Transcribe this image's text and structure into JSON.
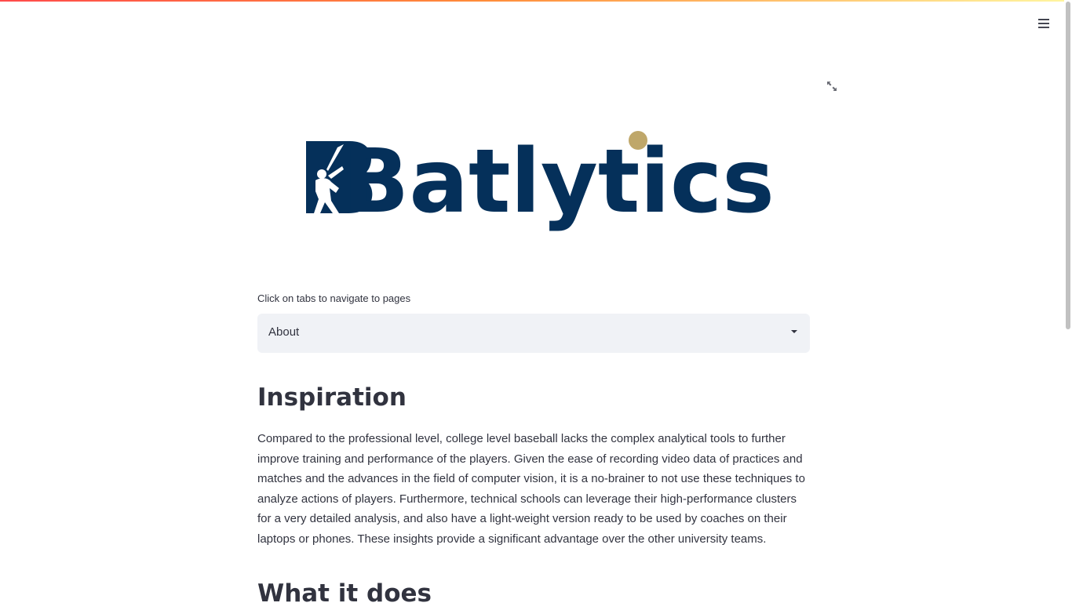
{
  "app": {
    "header": {
      "menu_icon": "hamburger-menu-icon"
    },
    "hero": {
      "logo_text": "Batlytics",
      "logo_colors": {
        "primary": "#05305a",
        "accent": "#bfa76a"
      },
      "fullscreen_icon": "expand-arrows-icon"
    },
    "navigation": {
      "label": "Click on tabs to navigate to pages",
      "selected_value": "About",
      "caret_icon": "caret-down-icon"
    },
    "content": {
      "sections": [
        {
          "heading": "Inspiration",
          "body": "Compared to the professional level, college level baseball lacks the complex analytical tools to further improve training and performance of the players. Given the ease of recording video data of practices and matches and the advances in the field of computer vision, it is a no-brainer to not use these techniques to analyze actions of players. Furthermore, technical schools can leverage their high-performance clusters for a very detailed analysis, and also have a light-weight version ready to be used by coaches on their laptops or phones. These insights provide a significant advantage over the other university teams."
        },
        {
          "heading": "What it does"
        }
      ]
    },
    "theme": {
      "accent": "#ff4b4b",
      "text": "#31333f",
      "select_background": "#f0f2f6"
    }
  }
}
